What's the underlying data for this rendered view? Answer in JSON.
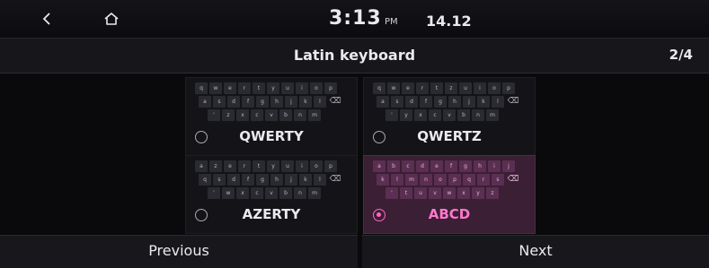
{
  "status": {
    "back_icon": "chevron-left-icon",
    "home_icon": "home-icon",
    "time": "3:13",
    "ampm": "PM",
    "date": "14.12"
  },
  "header": {
    "title": "Latin keyboard",
    "page": "2/4"
  },
  "layouts": [
    {
      "name": "QWERTY",
      "selected": false,
      "rows": [
        [
          "q",
          "w",
          "e",
          "r",
          "t",
          "y",
          "u",
          "i",
          "o",
          "p"
        ],
        [
          "a",
          "s",
          "d",
          "f",
          "g",
          "h",
          "j",
          "k",
          "l"
        ],
        [
          "'",
          "z",
          "x",
          "c",
          "v",
          "b",
          "n",
          "m"
        ]
      ]
    },
    {
      "name": "QWERTZ",
      "selected": false,
      "rows": [
        [
          "q",
          "w",
          "e",
          "r",
          "t",
          "z",
          "u",
          "i",
          "o",
          "p"
        ],
        [
          "a",
          "s",
          "d",
          "f",
          "g",
          "h",
          "j",
          "k",
          "l"
        ],
        [
          "'",
          "y",
          "x",
          "c",
          "v",
          "b",
          "n",
          "m"
        ]
      ]
    },
    {
      "name": "AZERTY",
      "selected": false,
      "rows": [
        [
          "a",
          "z",
          "e",
          "r",
          "t",
          "y",
          "u",
          "i",
          "o",
          "p"
        ],
        [
          "q",
          "s",
          "d",
          "f",
          "g",
          "h",
          "j",
          "k",
          "l"
        ],
        [
          "'",
          "w",
          "x",
          "c",
          "v",
          "b",
          "n",
          "m"
        ]
      ]
    },
    {
      "name": "ABCD",
      "selected": true,
      "rows": [
        [
          "a",
          "b",
          "c",
          "d",
          "e",
          "f",
          "g",
          "h",
          "i",
          "j"
        ],
        [
          "k",
          "l",
          "m",
          "n",
          "o",
          "p",
          "q",
          "r",
          "s"
        ],
        [
          "'",
          "t",
          "u",
          "v",
          "w",
          "x",
          "y",
          "z"
        ]
      ]
    }
  ],
  "backspace_icon": "⌫",
  "footer": {
    "previous": "Previous",
    "next": "Next"
  },
  "colors": {
    "accent": "#ff66c4",
    "selected_bg": "#3b1f34"
  }
}
